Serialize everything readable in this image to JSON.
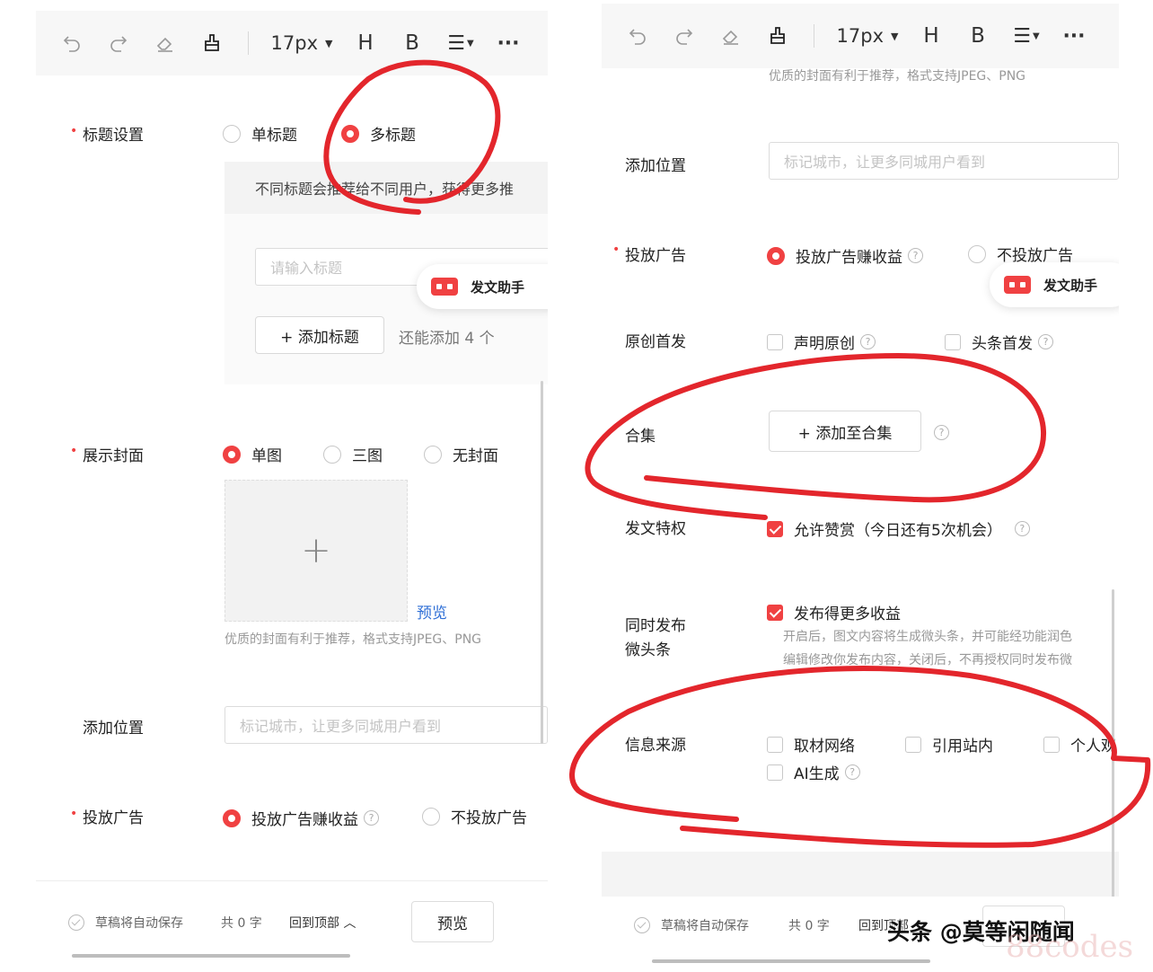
{
  "toolbar": {
    "icons": [
      "undo-icon",
      "redo-icon",
      "eraser-icon",
      "format-brush-icon"
    ],
    "font_size": "17px",
    "heading": "H",
    "bold": "B",
    "list": "☰",
    "more": "···"
  },
  "left": {
    "title_setting": {
      "label": "标题设置",
      "options": [
        "单标题",
        "多标题"
      ],
      "selected": "多标题",
      "tip": "不同标题会推荐给不同用户，获得更多推",
      "input_placeholder": "请输入标题",
      "add_button": "+ 添加标题",
      "remaining": "还能添加 4 个"
    },
    "helper": "发文助手",
    "cover": {
      "label": "展示封面",
      "options": [
        "单图",
        "三图",
        "无封面"
      ],
      "selected": "单图",
      "plus": "+",
      "preview_link": "预览",
      "hint": "优质的封面有利于推荐，格式支持JPEG、PNG"
    },
    "location": {
      "label": "添加位置",
      "placeholder": "标记城市，让更多同城用户看到"
    },
    "ads": {
      "label": "投放广告",
      "options": [
        "投放广告赚收益",
        "不投放广告"
      ],
      "selected": "投放广告赚收益"
    },
    "footer": {
      "autosave": "草稿将自动保存",
      "word_count": "共 0 字",
      "back_to_top": "回到顶部 ︿",
      "preview": "预览"
    }
  },
  "right": {
    "cover_hint": "优质的封面有利于推荐，格式支持JPEG、PNG",
    "location": {
      "label": "添加位置",
      "placeholder": "标记城市，让更多同城用户看到"
    },
    "ads": {
      "label": "投放广告",
      "options": [
        "投放广告赚收益",
        "不投放广告"
      ],
      "selected": "投放广告赚收益"
    },
    "helper": "发文助手",
    "original": {
      "label": "原创首发",
      "options": [
        "声明原创",
        "头条首发"
      ]
    },
    "collection": {
      "label": "合集",
      "button": "+ 添加至合集"
    },
    "privilege": {
      "label": "发文特权",
      "option": "允许赞赏（今日还有5次机会）"
    },
    "micro": {
      "label_line1": "同时发布",
      "label_line2": "微头条",
      "option": "发布得更多收益",
      "desc_line1": "开启后，图文内容将生成微头条，并可能经功能润色",
      "desc_line2": "编辑修改你发布内容，关闭后，不再授权同时发布微"
    },
    "source": {
      "label": "信息来源",
      "options": [
        "取材网络",
        "引用站内",
        "个人观",
        "AI生成"
      ]
    },
    "footer": {
      "autosave": "草稿将自动保存",
      "word_count": "共 0 字",
      "back_to_top": "回到顶部"
    }
  },
  "watermark": "头条 @莫等闲随闻",
  "watermark_faint": "88codes",
  "colors": {
    "accent": "#f04142",
    "link": "#2f6fd6",
    "annotation": "#e3262c"
  }
}
